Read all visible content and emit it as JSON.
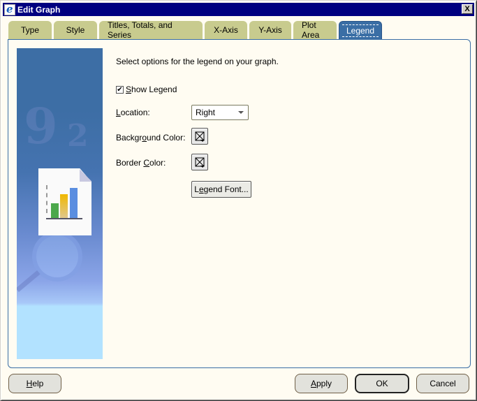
{
  "window": {
    "title": "Edit Graph",
    "close_label": "X"
  },
  "tabs": [
    {
      "label": "Type",
      "active": false
    },
    {
      "label": "Style",
      "active": false
    },
    {
      "label": "Titles, Totals, and Series",
      "active": false
    },
    {
      "label": "X-Axis",
      "active": false
    },
    {
      "label": "Y-Axis",
      "active": false
    },
    {
      "label": "Plot Area",
      "active": false
    },
    {
      "label": "Legend",
      "active": true
    }
  ],
  "legend_page": {
    "intro": "Select options for the legend on your graph.",
    "show_legend": {
      "label_mnemonic": "S",
      "label_rest": "how Legend",
      "checked": true
    },
    "location": {
      "label_mnemonic": "L",
      "label_rest": "ocation:",
      "value": "Right"
    },
    "background_color": {
      "label_pre": "Backgr",
      "label_mnemonic": "o",
      "label_post": "und Color:",
      "value": "none"
    },
    "border_color": {
      "label_pre": "Border ",
      "label_mnemonic": "C",
      "label_post": "olor:",
      "value": "none"
    },
    "legend_font_button": {
      "label_pre": "L",
      "label_mnemonic": "e",
      "label_post": "gend Font..."
    }
  },
  "footer": {
    "help": {
      "mnemonic": "H",
      "rest": "elp"
    },
    "apply": {
      "mnemonic": "A",
      "rest": "pply"
    },
    "ok": "OK",
    "cancel": "Cancel"
  },
  "colors": {
    "titlebar": "#000080",
    "tab_inactive": "#c8cb8e",
    "tab_active": "#3a6ea5",
    "panel_bg": "#fffcf2"
  }
}
